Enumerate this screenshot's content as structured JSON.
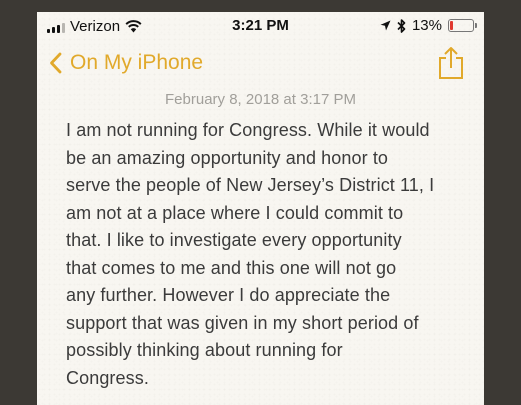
{
  "status_bar": {
    "carrier": "Verizon",
    "time": "3:21 PM",
    "battery_percent": "13%",
    "battery_level": 0.13,
    "icons": [
      "signal-bars-icon",
      "wifi-icon",
      "location-arrow-icon",
      "bluetooth-icon",
      "battery-icon"
    ]
  },
  "nav": {
    "back_label": "On My iPhone",
    "accent_color": "#e1a92b",
    "share_icon": "share-icon"
  },
  "note": {
    "date": "February 8, 2018 at 3:17 PM",
    "body": "I am not running for Congress. While it would\nbe an amazing opportunity and honor to\nserve the people of New Jersey’s District 11, I\nam not at a place where I could commit to\nthat. I like to investigate every opportunity\nthat comes to me and this one will not go\nany further. However I do appreciate the\nsupport that was given in my short period of\npossibly thinking about running for\nCongress."
  }
}
